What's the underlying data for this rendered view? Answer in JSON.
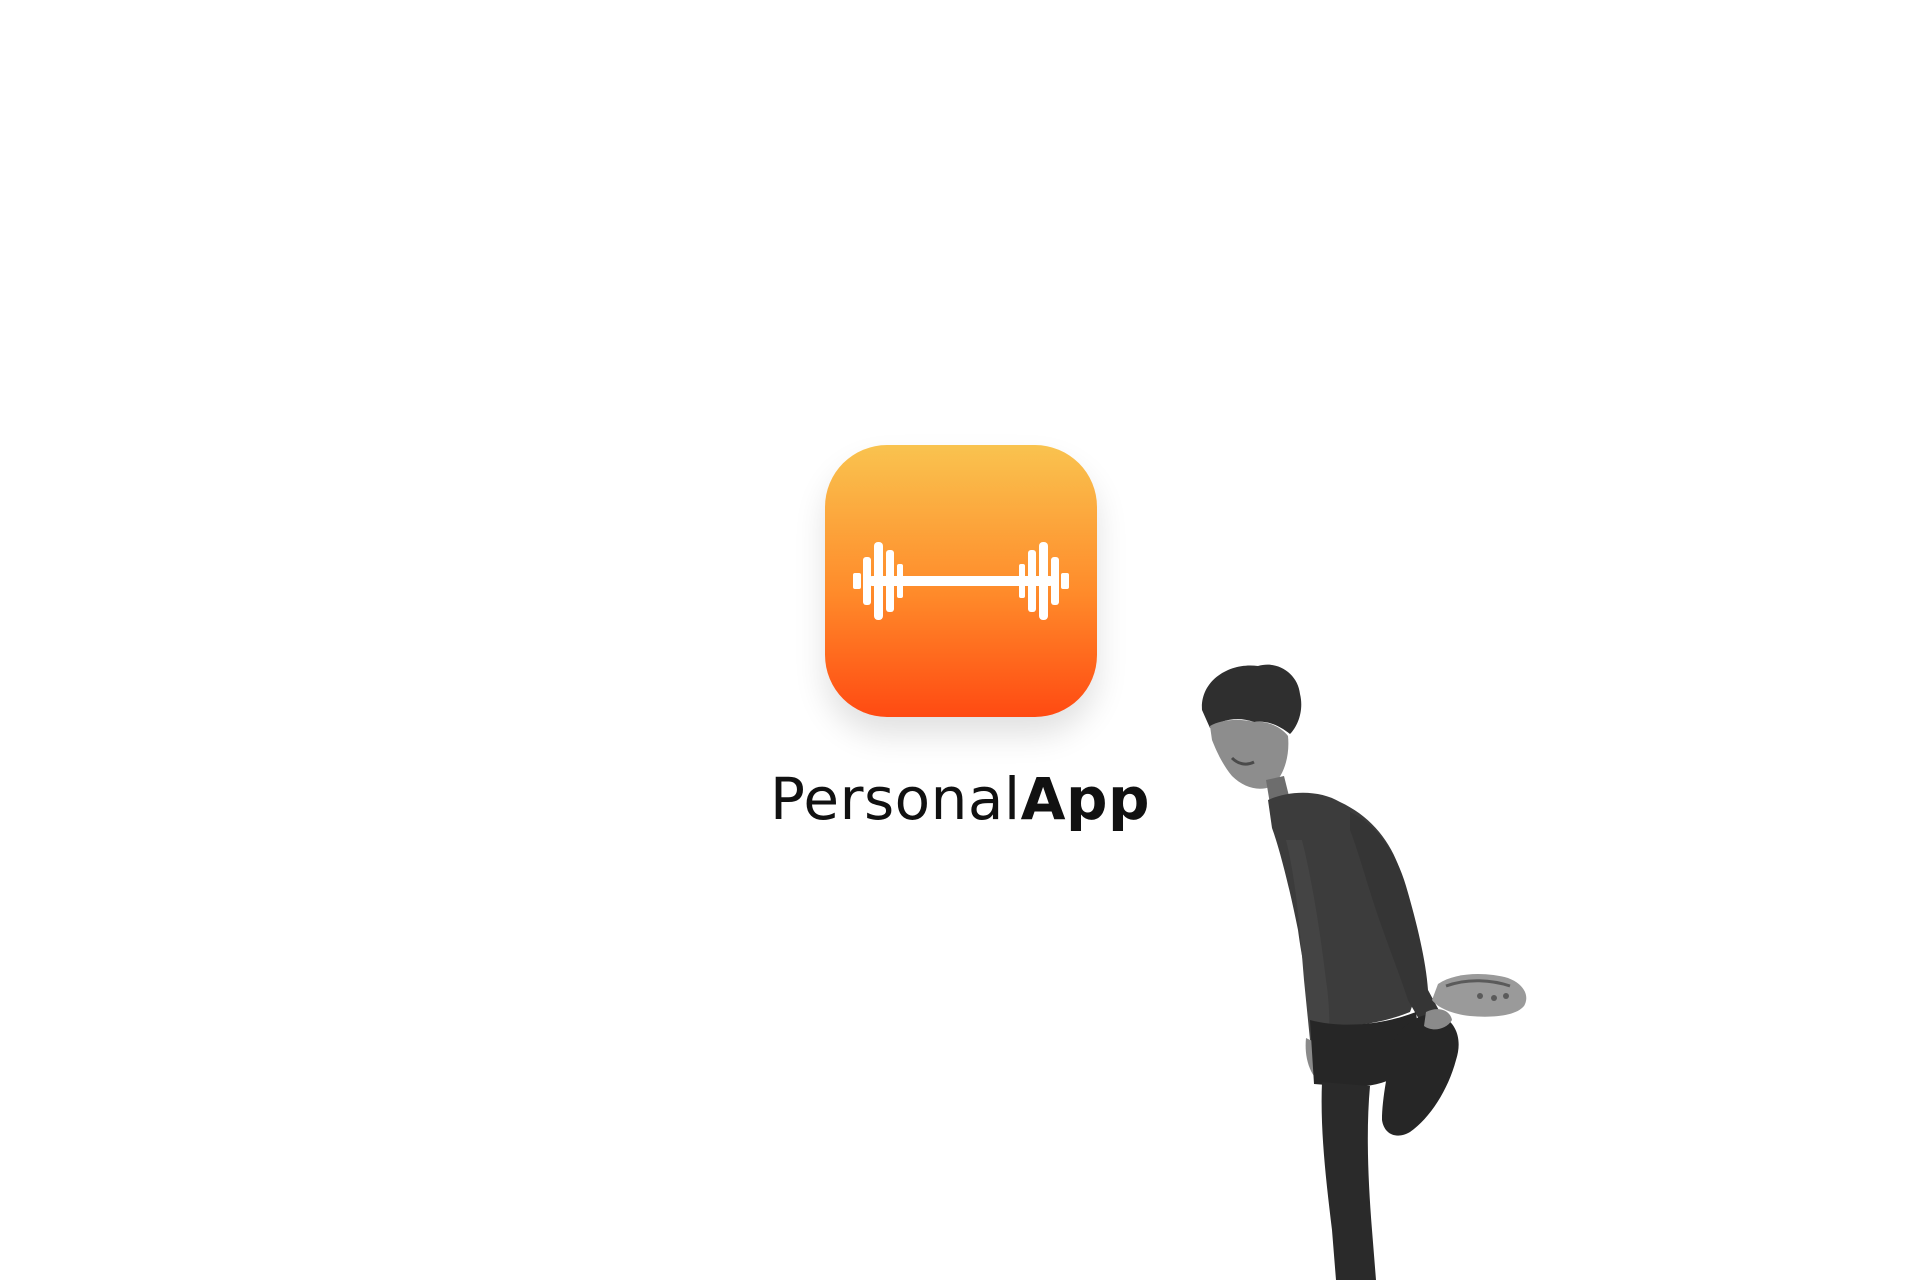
{
  "app": {
    "name_part_1": "Personal",
    "name_part_2": "App",
    "icon": "barbell-icon"
  },
  "colors": {
    "gradient_top": "#F9C34F",
    "gradient_bottom": "#FF4A12",
    "icon_glyph": "#FFFFFF",
    "wordmark": "#111111",
    "photo_tone": "#3a3a3a"
  },
  "photo": {
    "subject": "person-stretching-photo"
  }
}
